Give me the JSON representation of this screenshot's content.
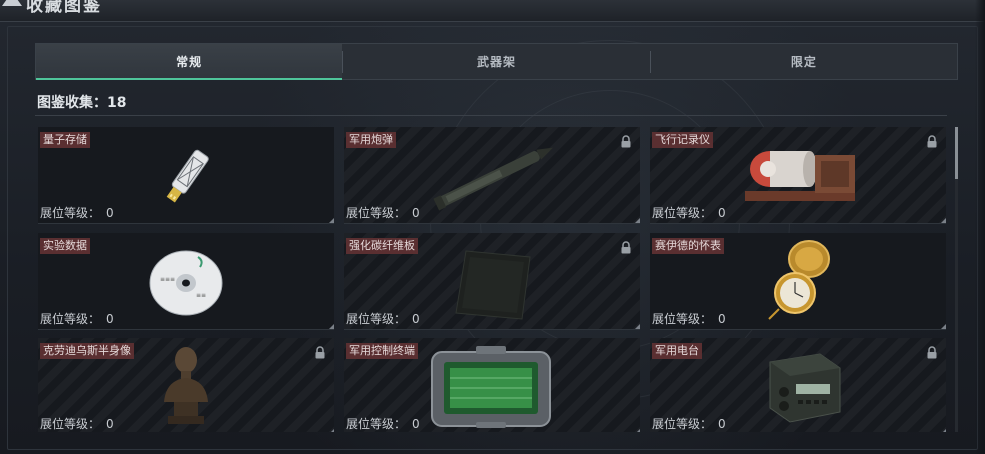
{
  "header": {
    "title": "收藏图鉴"
  },
  "tabs": [
    {
      "label": "常规",
      "active": true
    },
    {
      "label": "武器架",
      "active": false
    },
    {
      "label": "限定",
      "active": false
    }
  ],
  "collection": {
    "label": "图鉴收集：18"
  },
  "level_label": "展位等级：",
  "items": [
    {
      "name": "量子存储",
      "level": "0",
      "locked": false,
      "icon": "usb-drive-icon"
    },
    {
      "name": "军用炮弹",
      "level": "0",
      "locked": true,
      "icon": "artillery-shell-icon"
    },
    {
      "name": "飞行记录仪",
      "level": "0",
      "locked": true,
      "icon": "flight-recorder-icon"
    },
    {
      "name": "实验数据",
      "level": "0",
      "locked": false,
      "icon": "disc-icon"
    },
    {
      "name": "强化碳纤维板",
      "level": "0",
      "locked": true,
      "icon": "carbon-plate-icon"
    },
    {
      "name": "赛伊德的怀表",
      "level": "0",
      "locked": false,
      "icon": "pocket-watch-icon"
    },
    {
      "name": "克劳迪乌斯半身像",
      "level": "0",
      "locked": true,
      "icon": "bust-statue-icon"
    },
    {
      "name": "军用控制终端",
      "level": "0",
      "locked": false,
      "icon": "control-terminal-icon"
    },
    {
      "name": "军用电台",
      "level": "0",
      "locked": true,
      "icon": "military-radio-icon"
    }
  ],
  "colors": {
    "accent": "#4fc59a",
    "label_bg": "#5a2f31",
    "panel_bg": "#1b1f26"
  }
}
